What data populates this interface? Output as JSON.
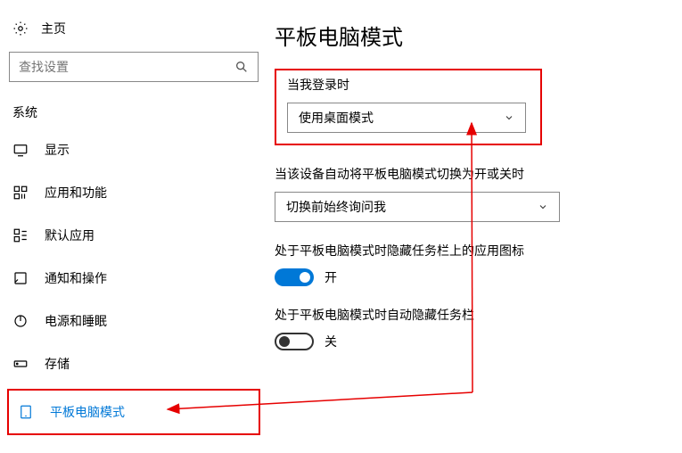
{
  "sidebar": {
    "home_label": "主页",
    "search_placeholder": "查找设置",
    "section_label": "系统",
    "items": [
      {
        "label": "显示"
      },
      {
        "label": "应用和功能"
      },
      {
        "label": "默认应用"
      },
      {
        "label": "通知和操作"
      },
      {
        "label": "电源和睡眠"
      },
      {
        "label": "存储"
      },
      {
        "label": "平板电脑模式"
      }
    ]
  },
  "main": {
    "title": "平板电脑模式",
    "login_label": "当我登录时",
    "login_value": "使用桌面模式",
    "auto_switch_label": "当该设备自动将平板电脑模式切换为开或关时",
    "auto_switch_value": "切换前始终询问我",
    "hide_icons_label": "处于平板电脑模式时隐藏任务栏上的应用图标",
    "hide_icons_state": "开",
    "auto_hide_taskbar_label": "处于平板电脑模式时自动隐藏任务栏",
    "auto_hide_taskbar_state": "关"
  }
}
